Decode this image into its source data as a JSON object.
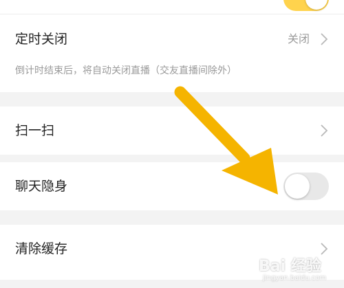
{
  "rows": {
    "auto_close": {
      "label": "定时关闭",
      "value": "关闭",
      "note": "倒计时结束后，将自动关闭直播（交友直播间除外）"
    },
    "scan": {
      "label": "扫一扫"
    },
    "invisible_chat": {
      "label": "聊天隐身",
      "toggle_state": "off"
    },
    "clear_cache": {
      "label": "清除缓存"
    }
  },
  "top_toggle": {
    "state": "on",
    "color": "#ffd34d"
  },
  "annotation": {
    "arrow_color": "#f5b400"
  },
  "watermark": {
    "text": "Bai 经验",
    "url": "jingyan.baidu.com"
  }
}
